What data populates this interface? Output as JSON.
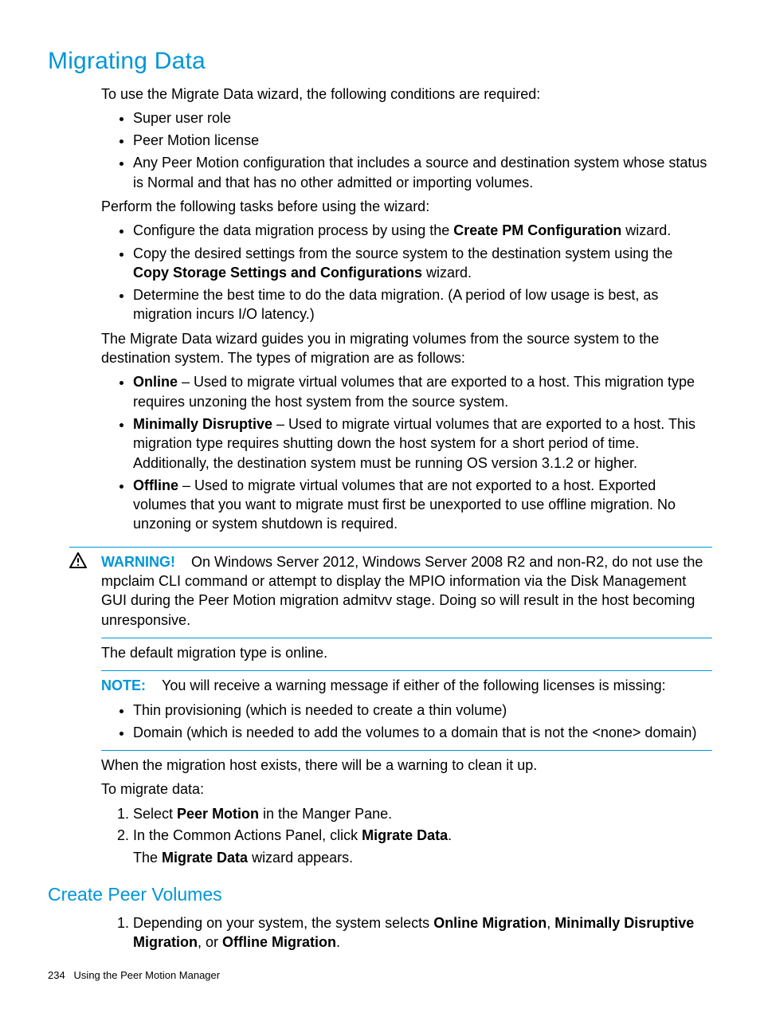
{
  "page": {
    "title": "Migrating Data",
    "intro": "To use the Migrate Data wizard, the following conditions are required:",
    "req1": "Super user role",
    "req2": "Peer Motion license",
    "req3": "Any Peer Motion configuration that includes a source and destination system whose status is Normal and that has no other admitted or importing volumes.",
    "perform": "Perform the following tasks before using the wizard:",
    "task1a": "Configure the data migration process by using the ",
    "task1b": "Create PM Configuration",
    "task1c": " wizard.",
    "task2a": "Copy the desired settings from the source system to the destination system using the ",
    "task2b": "Copy Storage Settings and Configurations",
    "task2c": " wizard.",
    "task3": "Determine the best time to do the data migration. (A period of low usage is best, as migration incurs I/O latency.)",
    "guide": "The Migrate Data wizard guides you in migrating volumes from the source system to the destination system. The types of migration are as follows:",
    "m1a": "Online",
    "m1b": " – Used to migrate virtual volumes that are exported to a host. This migration type requires unzoning the host system from the source system.",
    "m2a": "Minimally Disruptive",
    "m2b": " – Used to migrate virtual volumes that are exported to a host. This migration type requires shutting down the host system for a short period of time. Additionally, the destination system must be running OS version 3.1.2 or higher.",
    "m3a": "Offline",
    "m3b": " – Used to migrate virtual volumes that are not exported to a host. Exported volumes that you want to migrate must first be unexported to use offline migration. No unzoning or system shutdown is required.",
    "warnlabel": "WARNING!",
    "warntext": "On Windows Server 2012, Windows Server 2008 R2 and non-R2, do not use the mpclaim CLI command or attempt to display the MPIO information via the Disk Management GUI during the Peer Motion migration admitvv stage. Doing so will result in the host becoming unresponsive.",
    "default": "The default migration type is online.",
    "notelabel": "NOTE:",
    "notetext": "You will receive a warning message if either of the following licenses is missing:",
    "lic1": "Thin provisioning (which is needed to create a thin volume)",
    "lic2": "Domain (which is needed to add the volumes to a domain that is not the <none> domain)",
    "warn2": "When the migration host exists, there will be a warning to clean it up.",
    "tomigrate": "To migrate data:",
    "step1a": "Select ",
    "step1b": "Peer Motion",
    "step1c": " in the Manger Pane.",
    "step2a": "In the Common Actions Panel, click ",
    "step2b": "Migrate Data",
    "step2c": ".",
    "step2d": "The ",
    "step2e": "Migrate Data",
    "step2f": " wizard appears.",
    "h2": "Create Peer Volumes",
    "cpv1a": "Depending on your system, the system selects ",
    "cpv1b": "Online Migration",
    "cpv1c": ", ",
    "cpv1d": "Minimally Disruptive Migration",
    "cpv1e": ", or ",
    "cpv1f": "Offline Migration",
    "cpv1g": ".",
    "footer_num": "234",
    "footer_text": "Using the Peer Motion Manager"
  }
}
